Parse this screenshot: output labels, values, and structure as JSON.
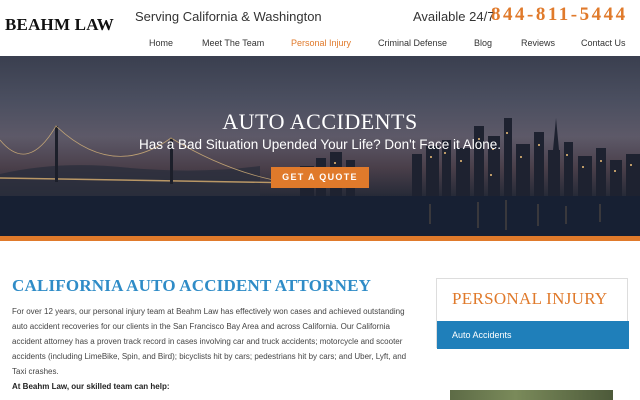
{
  "header": {
    "logo": "BEAHM LAW",
    "tagline": "Serving California & Washington",
    "availability": "Available 24/7",
    "phone": "844-811-5444"
  },
  "nav": {
    "items": [
      {
        "label": "Home"
      },
      {
        "label": "Meet The Team"
      },
      {
        "label": "Personal Injury"
      },
      {
        "label": "Criminal Defense"
      },
      {
        "label": "Blog"
      },
      {
        "label": "Reviews"
      },
      {
        "label": "Contact Us"
      }
    ],
    "active": "Personal Injury"
  },
  "hero": {
    "title": "AUTO ACCIDENTS",
    "subtitle": "Has a Bad Situation Upended Your Life? Don't Face it Alone.",
    "button_label": "GET A QUOTE"
  },
  "main": {
    "title": "CALIFORNIA AUTO ACCIDENT ATTORNEY",
    "paragraph": "For over 12 years, our personal injury team at Beahm Law has effectively won cases and achieved outstanding auto accident recoveries for our clients in the San Francisco Bay Area and across California. Our California accident attorney has a proven track record in cases involving car and truck accidents; motorcycle and scooter accidents (including LimeBike, Spin, and Bird); bicyclists hit by cars; pedestrians hit by cars; and Uber, Lyft, and Taxi crashes.",
    "help_heading": "At Beahm Law, our skilled team can help:"
  },
  "sidebar": {
    "title": "PERSONAL INJURY",
    "active_link": "Auto Accidents"
  },
  "colors": {
    "accent": "#e07a2b",
    "link_blue": "#2f8cc7",
    "sidebar_active": "#1f7fba"
  }
}
